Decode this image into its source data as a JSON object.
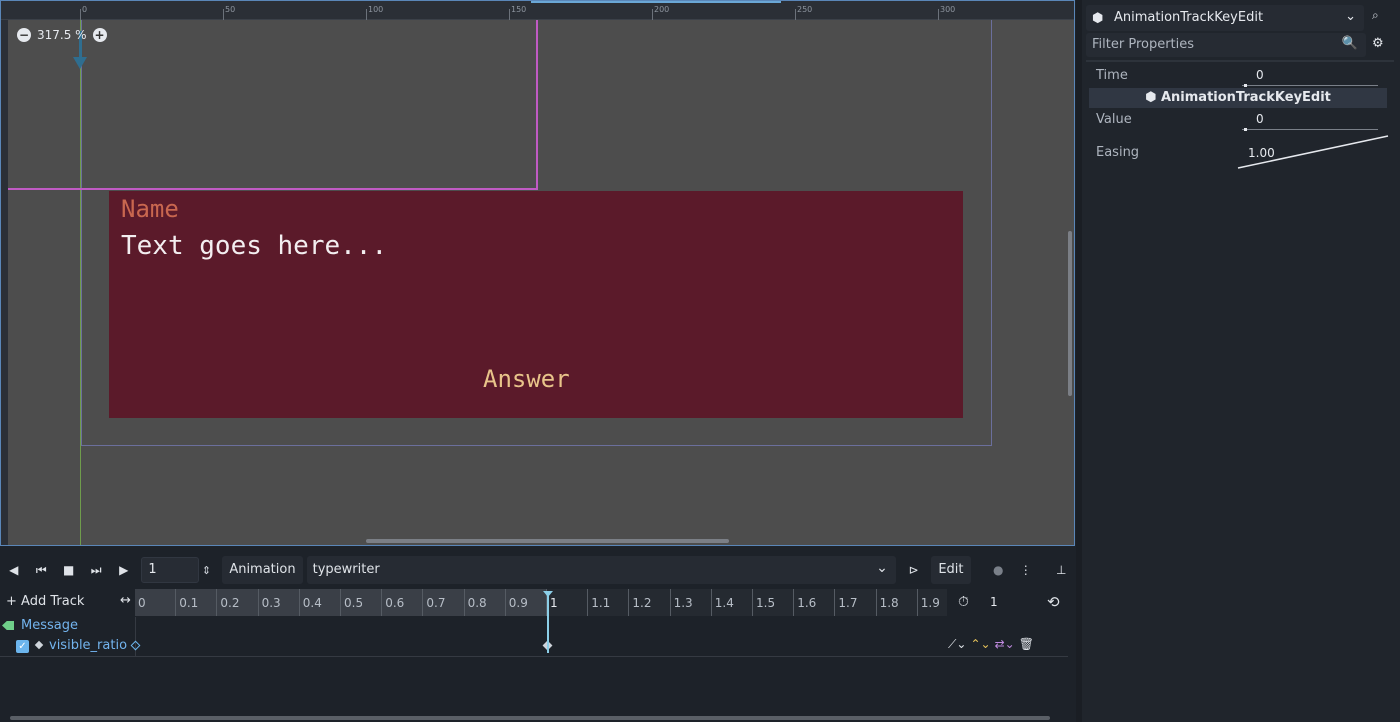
{
  "viewport": {
    "zoom_label": "317.5 %",
    "ruler_labels": [
      "0",
      "50",
      "100",
      "150",
      "200",
      "250",
      "300"
    ],
    "dialog": {
      "name": "Name",
      "text": "Text goes here...",
      "answer": "Answer",
      "bg_color": "#5b1a2a",
      "name_color": "#c9674f",
      "answer_color": "#e8c48a"
    }
  },
  "animation": {
    "frame_value": "1",
    "animation_label": "Animation",
    "animation_name": "typewriter",
    "edit_label": "Edit",
    "add_track_label": "Add Track",
    "timeline_labels": [
      "0",
      "0.1",
      "0.2",
      "0.3",
      "0.4",
      "0.5",
      "0.6",
      "0.7",
      "0.8",
      "0.9",
      "1",
      "1.1",
      "1.2",
      "1.3",
      "1.4",
      "1.5",
      "1.6",
      "1.7",
      "1.8",
      "1.9"
    ],
    "snap_value": "1",
    "track_group": "Message",
    "track_name": "visible_ratio"
  },
  "inspector": {
    "object_name": "AnimationTrackKeyEdit",
    "filter_placeholder": "Filter Properties",
    "time_label": "Time",
    "time_value": "0",
    "section_title": "AnimationTrackKeyEdit",
    "value_label": "Value",
    "value_value": "0",
    "easing_label": "Easing",
    "easing_value": "1.00"
  },
  "colors": {
    "accent": "#6cb5ed",
    "guide_magenta": "#c05ac4",
    "viewport_bg": "#4d4d4d"
  }
}
